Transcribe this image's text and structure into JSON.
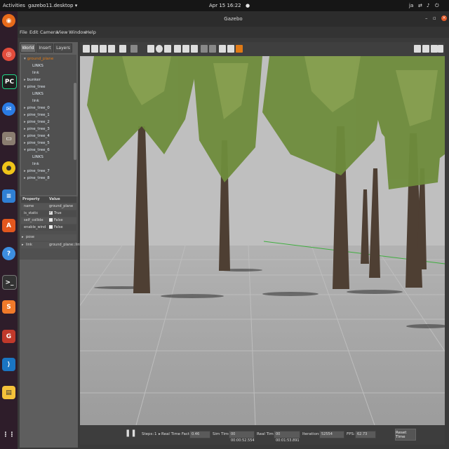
{
  "topbar": {
    "activities": "Activities",
    "app_name": "gazebo11.desktop",
    "clock": "Apr 15  16:22",
    "user": "ja"
  },
  "window": {
    "title": "Gazebo"
  },
  "menu": [
    "File",
    "Edit",
    "Camera",
    "View",
    "Window",
    "Help"
  ],
  "left_panel": {
    "tabs": [
      "World",
      "Insert",
      "Layers"
    ],
    "active_tab": "World",
    "tree": [
      {
        "label": "ground_plane",
        "indent": 0,
        "expanded": true,
        "highlight": true
      },
      {
        "label": "LINKS",
        "indent": 2,
        "expanded": null,
        "highlight": false
      },
      {
        "label": "link",
        "indent": 2,
        "expanded": null,
        "highlight": false
      },
      {
        "label": "bunker",
        "indent": 0,
        "expanded": false,
        "highlight": false
      },
      {
        "label": "pine_tree",
        "indent": 0,
        "expanded": true,
        "highlight": false
      },
      {
        "label": "LINKS",
        "indent": 2,
        "expanded": null,
        "highlight": false
      },
      {
        "label": "link",
        "indent": 2,
        "expanded": null,
        "highlight": false
      },
      {
        "label": "pine_tree_0",
        "indent": 0,
        "expanded": false,
        "highlight": false
      },
      {
        "label": "pine_tree_1",
        "indent": 0,
        "expanded": false,
        "highlight": false
      },
      {
        "label": "pine_tree_2",
        "indent": 0,
        "expanded": false,
        "highlight": false
      },
      {
        "label": "pine_tree_3",
        "indent": 0,
        "expanded": false,
        "highlight": false
      },
      {
        "label": "pine_tree_4",
        "indent": 0,
        "expanded": false,
        "highlight": false
      },
      {
        "label": "pine_tree_5",
        "indent": 0,
        "expanded": false,
        "highlight": false
      },
      {
        "label": "pine_tree_6",
        "indent": 0,
        "expanded": true,
        "highlight": false
      },
      {
        "label": "LINKS",
        "indent": 2,
        "expanded": null,
        "highlight": false
      },
      {
        "label": "link",
        "indent": 2,
        "expanded": null,
        "highlight": false
      },
      {
        "label": "pine_tree_7",
        "indent": 0,
        "expanded": false,
        "highlight": false
      },
      {
        "label": "pine_tree_8",
        "indent": 0,
        "expanded": false,
        "highlight": false
      }
    ],
    "properties": {
      "header": [
        "Property",
        "Value"
      ],
      "rows": [
        {
          "name": "name",
          "value": "ground_plane",
          "check": null
        },
        {
          "name": "is_static",
          "value": "True",
          "check": true
        },
        {
          "name": "self_collide",
          "value": "False",
          "check": false
        },
        {
          "name": "enable_wind",
          "value": "False",
          "check": false
        }
      ],
      "groups": [
        {
          "name": "pose",
          "value": ""
        },
        {
          "name": "link",
          "value": "ground_plane::link"
        }
      ]
    }
  },
  "bottom_bar": {
    "steps_label": "Steps:",
    "steps_value": "1",
    "rtf_label": "Real Time Factor:",
    "rtf_value": "0.46",
    "sim_time_label": "Sim Time:",
    "sim_time_value": "00 00:00:52.554",
    "real_time_label": "Real Time:",
    "real_time_value": "00 00:01:53.891",
    "iterations_label": "Iterations:",
    "iterations_value": "52554",
    "fps_label": "FPS:",
    "fps_value": "62.73",
    "reset_label": "Reset Time"
  },
  "colors": {
    "accent_orange": "#e07a16",
    "dock_bg": "#2e1d2a",
    "sky": "#bdbdbd",
    "ground": "#a8a8a8",
    "foliage": "#6b8a3a",
    "trunk": "#4a3a2e"
  },
  "icons": [
    "firefox-icon",
    "chrome-icon",
    "pycharm-icon",
    "thunderbird-icon",
    "files-icon",
    "rhythmbox-icon",
    "writer-icon",
    "software-icon",
    "help-icon",
    "terminal-icon",
    "sublime-icon",
    "gazebo-icon",
    "vscode-icon",
    "notes-icon",
    "apps-grid-icon"
  ]
}
